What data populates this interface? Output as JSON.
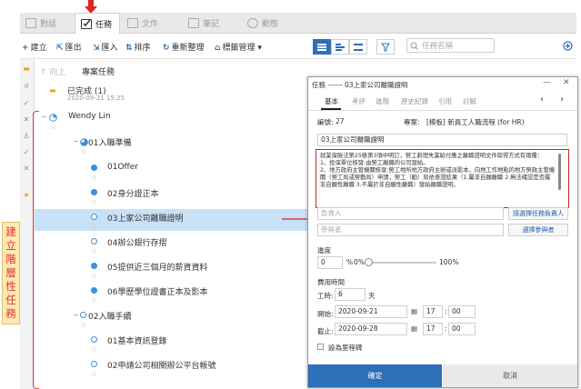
{
  "tabs": [
    {
      "label": "對話"
    },
    {
      "label": "任務"
    },
    {
      "label": "文件"
    },
    {
      "label": "筆記"
    },
    {
      "label": "動態"
    }
  ],
  "toolbar": {
    "new": "建立",
    "export": "匯出",
    "import": "匯入",
    "sort": "排序",
    "reorganize": "重新整理",
    "tag_manage": "標籤管理",
    "search_placeholder": "任務名稱"
  },
  "list": {
    "up": "向上",
    "project": "專案任務",
    "completed_label": "已完成 (1)",
    "completed_date": "2020-09-21 15:25",
    "owner": "Wendy Lin",
    "groups": [
      {
        "name": "01入職準備",
        "items": [
          "01Offer",
          "02身分證正本",
          "03上家公司離職證明",
          "04辦公銀行存摺",
          "05提供近三個月的薪資資料",
          "06學歷學位證書正本及影本"
        ]
      },
      {
        "name": "02入職手續",
        "items": [
          "01基本資訊登錄",
          "02申請公司相關辦公平台帳號"
        ]
      }
    ]
  },
  "annotation": {
    "chars": [
      "建",
      "立",
      "階",
      "層",
      "性",
      "任",
      "務"
    ]
  },
  "dialog": {
    "title": "任務 ------ 03上家公司離職證明",
    "tabs": [
      "基本",
      "考評",
      "進階",
      "歷史紀錄",
      "引用",
      "討解"
    ],
    "id_label": "編號:",
    "id_value": "27",
    "project_label": "專案:",
    "project_value": "[模板] 新員工人職流程 (for HR)",
    "task_name": "03上家公司離職證明",
    "description": "就業保險法第25條第3項中明訂，勞工辭理失業給付應之離職證明文件取得方式有兩種：\n1、投保單位核發:由勞工離職的公司發給。\n2、地方政府主管機關核發:勞工地所地方政府主辦或派影本，向地工作地點的地方勞政主管機關（勞工局或勞動局）申請，勞工（勸）局依查證結果（1.屬非自願離職 2.無法確認是否屬非自願性離職 3.不屬於非自願性離職）發給離職證明。",
    "assignee_placeholder": "負責人",
    "assignee_btn": "請選擇任務負責人",
    "participant_placeholder": "參與者",
    "participant_btn": "選擇參與者",
    "progress_label": "進度",
    "progress_value": "0",
    "progress_pct": "%",
    "progress_start": "0%",
    "progress_end": "100%",
    "progress_fraction": 0,
    "time_label": "費用時間",
    "workday_label": "工時:",
    "workday_value": "6",
    "workday_unit": "天",
    "start_label": "開始:",
    "start_date": "2020-09-21",
    "start_h": "17",
    "start_m": "00",
    "end_label": "截止:",
    "end_date": "2020-09-28",
    "end_h": "17",
    "end_m": "00",
    "milestone_label": "設為里程碑",
    "ok": "確定",
    "cancel": "取消"
  }
}
